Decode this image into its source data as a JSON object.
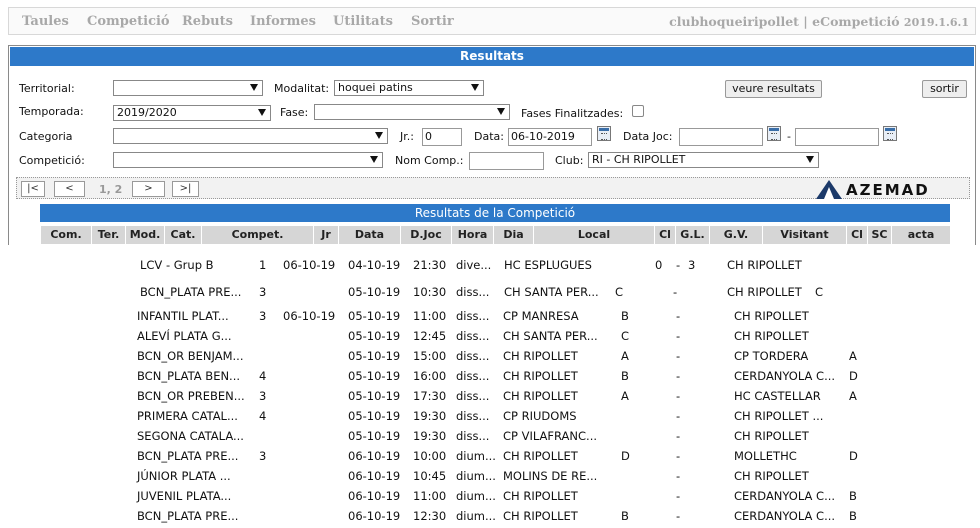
{
  "nav": {
    "items": [
      "Taules",
      "Competició",
      "Rebuts",
      "Informes",
      "Utilitats",
      "Sortir"
    ],
    "brand": "clubhoqueiripollet | eCompetició",
    "version": "2019.1.6.1"
  },
  "panel": {
    "title": "Resultats"
  },
  "filters": {
    "territorial_label": "Territorial:",
    "territorial_value": "",
    "modalitat_label": "Modalitat:",
    "modalitat_value": "hoquei patins",
    "veure_button": "veure resultats",
    "sortir_button": "sortir",
    "temporada_label": "Temporada:",
    "temporada_value": "2019/2020",
    "fase_label": "Fase:",
    "fase_value": "",
    "fases_finalitzades_label": "Fases Finalitzades:",
    "categoria_label": "Categoria",
    "categoria_value": "",
    "jr_label": "Jr.:",
    "jr_value": "0",
    "data_label": "Data:",
    "data_value": "06-10-2019",
    "data_joc_label": "Data Joc:",
    "data_joc_from": "",
    "data_joc_sep": "-",
    "data_joc_to": "",
    "competicio_label": "Competició:",
    "competicio_value": "",
    "nom_comp_label": "Nom Comp.:",
    "nom_comp_value": "",
    "club_label": "Club:",
    "club_value": "RI - CH RIPOLLET"
  },
  "pager": {
    "first": "|<",
    "prev": "<",
    "info": "1, 2",
    "next": ">",
    "last": ">|",
    "logo": "AZEMAD"
  },
  "results": {
    "title": "Resultats de la Competició",
    "columns": [
      "Com.",
      "Ter.",
      "Mod.",
      "Cat.",
      "Compet.",
      "Jr",
      "Data",
      "D.Joc",
      "Hora",
      "Dia",
      "Local",
      "Cl",
      "G.L.",
      "G.V.",
      "Visitant",
      "Cl",
      "SC",
      "acta"
    ],
    "rows": [
      {
        "compet": "LCV - Grup B",
        "jr": "1",
        "data": "06-10-19",
        "djoc": "04-10-19",
        "hora": "21:30",
        "dia": "dive...",
        "local": "HC ESPLUGUES",
        "cl": "",
        "gl": "0",
        "sep": "-",
        "gv": "3",
        "visitant": "CH RIPOLLET",
        "cl2": ""
      },
      {
        "compet": "BCN_PLATA PRE...",
        "jr": "3",
        "data": "",
        "djoc": "05-10-19",
        "hora": "10:30",
        "dia": "diss...",
        "local": "CH SANTA PER...",
        "cl": "C",
        "gl": "",
        "sep": "-",
        "gv": "",
        "visitant": "CH RIPOLLET",
        "cl2": "C"
      },
      {
        "compet": "INFANTIL PLAT...",
        "jr": "3",
        "data": "06-10-19",
        "djoc": "05-10-19",
        "hora": "11:00",
        "dia": "diss...",
        "local": "CP MANRESA",
        "cl": "B",
        "gl": "",
        "sep": "-",
        "gv": "",
        "visitant": "CH RIPOLLET",
        "cl2": ""
      },
      {
        "compet": "ALEVÍ PLATA G...",
        "jr": "",
        "data": "",
        "djoc": "05-10-19",
        "hora": "12:45",
        "dia": "diss...",
        "local": "CH SANTA PER...",
        "cl": "C",
        "gl": "",
        "sep": "-",
        "gv": "",
        "visitant": "CH RIPOLLET",
        "cl2": ""
      },
      {
        "compet": "BCN_OR BENJAM...",
        "jr": "",
        "data": "",
        "djoc": "05-10-19",
        "hora": "15:00",
        "dia": "diss...",
        "local": "CH RIPOLLET",
        "cl": "A",
        "gl": "",
        "sep": "-",
        "gv": "",
        "visitant": "CP TORDERA",
        "cl2": "A"
      },
      {
        "compet": "BCN_PLATA BEN...",
        "jr": "4",
        "data": "",
        "djoc": "05-10-19",
        "hora": "16:00",
        "dia": "diss...",
        "local": "CH RIPOLLET",
        "cl": "B",
        "gl": "",
        "sep": "-",
        "gv": "",
        "visitant": "CERDANYOLA C...",
        "cl2": "D"
      },
      {
        "compet": "BCN_OR PREBEN...",
        "jr": "3",
        "data": "",
        "djoc": "05-10-19",
        "hora": "17:30",
        "dia": "diss...",
        "local": "CH RIPOLLET",
        "cl": "A",
        "gl": "",
        "sep": "-",
        "gv": "",
        "visitant": "HC CASTELLAR",
        "cl2": "A"
      },
      {
        "compet": "PRIMERA CATAL...",
        "jr": "4",
        "data": "",
        "djoc": "05-10-19",
        "hora": "19:30",
        "dia": "diss...",
        "local": "CP RIUDOMS",
        "cl": "",
        "gl": "",
        "sep": "-",
        "gv": "",
        "visitant": "CH RIPOLLET ...",
        "cl2": ""
      },
      {
        "compet": "SEGONA CATALA...",
        "jr": "",
        "data": "",
        "djoc": "05-10-19",
        "hora": "19:30",
        "dia": "diss...",
        "local": "CP VILAFRANC...",
        "cl": "",
        "gl": "",
        "sep": "-",
        "gv": "",
        "visitant": "CH RIPOLLET",
        "cl2": ""
      },
      {
        "compet": "BCN_PLATA PRE...",
        "jr": "3",
        "data": "",
        "djoc": "06-10-19",
        "hora": "10:00",
        "dia": "dium...",
        "local": "CH RIPOLLET",
        "cl": "D",
        "gl": "",
        "sep": "-",
        "gv": "",
        "visitant": "MOLLETHC",
        "cl2": "D"
      },
      {
        "compet": "JÚNIOR PLATA ...",
        "jr": "",
        "data": "",
        "djoc": "06-10-19",
        "hora": "10:45",
        "dia": "dium...",
        "local": "MOLINS DE RE...",
        "cl": "",
        "gl": "",
        "sep": "-",
        "gv": "",
        "visitant": "CH RIPOLLET",
        "cl2": ""
      },
      {
        "compet": "JUVENIL PLATA...",
        "jr": "",
        "data": "",
        "djoc": "06-10-19",
        "hora": "11:00",
        "dia": "dium...",
        "local": "CH RIPOLLET",
        "cl": "",
        "gl": "",
        "sep": "-",
        "gv": "",
        "visitant": "CERDANYOLA C...",
        "cl2": "B"
      },
      {
        "compet": "BCN_PLATA PRE...",
        "jr": "",
        "data": "",
        "djoc": "06-10-19",
        "hora": "12:30",
        "dia": "dium...",
        "local": "CH RIPOLLET",
        "cl": "B",
        "gl": "",
        "sep": "-",
        "gv": "",
        "visitant": "CERDANYOLA C...",
        "cl2": "B"
      }
    ]
  }
}
